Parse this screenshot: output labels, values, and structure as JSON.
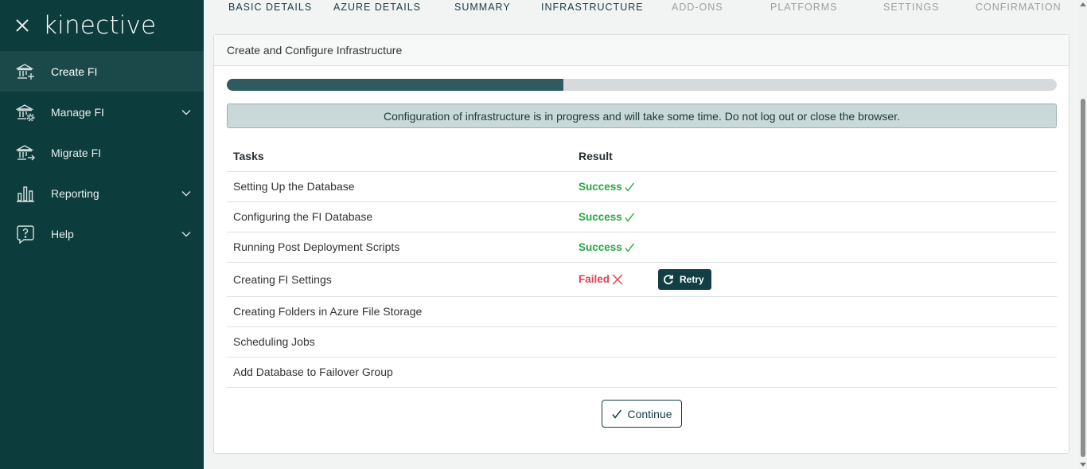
{
  "sidebar": {
    "brand": "kinective",
    "items": [
      {
        "label": "Create FI",
        "icon": "bank-add-icon",
        "active": true,
        "expandable": false
      },
      {
        "label": "Manage FI",
        "icon": "bank-gear-icon",
        "active": false,
        "expandable": true
      },
      {
        "label": "Migrate FI",
        "icon": "bank-arrow-icon",
        "active": false,
        "expandable": false
      },
      {
        "label": "Reporting",
        "icon": "bar-chart-icon",
        "active": false,
        "expandable": true
      },
      {
        "label": "Help",
        "icon": "help-bubble-icon",
        "active": false,
        "expandable": true
      }
    ]
  },
  "steps": [
    {
      "label": "BASIC DETAILS",
      "status": "done"
    },
    {
      "label": "AZURE DETAILS",
      "status": "done"
    },
    {
      "label": "SUMMARY",
      "status": "done"
    },
    {
      "label": "INFRASTRUCTURE",
      "status": "current"
    },
    {
      "label": "ADD-ONS",
      "status": "pending"
    },
    {
      "label": "PLATFORMS",
      "status": "pending"
    },
    {
      "label": "SETTINGS",
      "status": "pending"
    },
    {
      "label": "CONFIRMATION",
      "status": "pending"
    }
  ],
  "card": {
    "title": "Create and Configure Infrastructure",
    "progress_fraction": 0.406,
    "notice": "Configuration of infrastructure is in progress and will take some time. Do not log out or close the browser.",
    "table": {
      "headers": [
        "Tasks",
        "Result"
      ],
      "rows": [
        {
          "task": "Setting Up the Database",
          "result": "Success",
          "status": "success"
        },
        {
          "task": "Configuring the FI Database",
          "result": "Success",
          "status": "success"
        },
        {
          "task": "Running Post Deployment Scripts",
          "result": "Success",
          "status": "success"
        },
        {
          "task": "Creating FI Settings",
          "result": "Failed",
          "status": "failed",
          "action": "Retry"
        },
        {
          "task": "Creating Folders in Azure File Storage",
          "result": "",
          "status": "none"
        },
        {
          "task": "Scheduling Jobs",
          "result": "",
          "status": "none"
        },
        {
          "task": "Add Database to Failover Group",
          "result": "",
          "status": "none"
        }
      ]
    },
    "continue_label": "Continue"
  },
  "colors": {
    "sidebar_bg": "#0d3c3c",
    "accent": "#123f43",
    "success": "#28a745",
    "failed": "#e0434c",
    "progress_fill": "#2f5b60"
  }
}
